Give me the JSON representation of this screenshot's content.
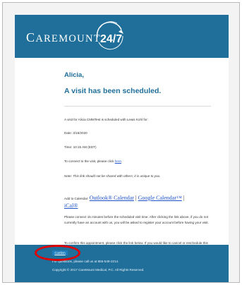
{
  "header": {
    "brand": "CareMount",
    "badge": "24/7"
  },
  "message": {
    "greeting": "Alicia,",
    "headline": "A visit has been scheduled.",
    "visit_for": "A visit for Alicia CMMTest is scheduled with Lewis Kohl for:",
    "date": "Date: 3/18/2020",
    "time": "Time: 10:15 AM (EDT)",
    "connect_prefix": "To connect to the visit, please click ",
    "connect_link": "here",
    "connect_suffix": ".",
    "note": "Note: This link should not be shared with others; it is unique to you.",
    "calendar_prefix": "Add to Calendar: ",
    "calendar_outlook": "Outlook® Calendar",
    "calendar_sep": " | ",
    "calendar_google": "Google Calendar™",
    "calendar_sep2": " | ",
    "calendar_ical": "iCal®",
    "connect_early": "Please connect 15 minutes before the scheduled visit time. After clicking the link above, if you do not currently have an account with us, you will be asked to register your account before having your visit.",
    "confirm_text": "To confirm this appointment, please click the link below. If you would like to cancel or reschedule this appointment please call your Doctor's office.",
    "confirm_link": "› Confirm",
    "confirm_button": "Confirm"
  },
  "footer": {
    "questions": "For questions, please call us at 855-549-2214.",
    "copyright": "Copyright © 2017 CareMount Medical, P.C. All Rights Reserved."
  },
  "colors": {
    "brand_blue": "#1f6f9a",
    "link_blue": "#2255cc",
    "annotation_red": "#e00000"
  }
}
